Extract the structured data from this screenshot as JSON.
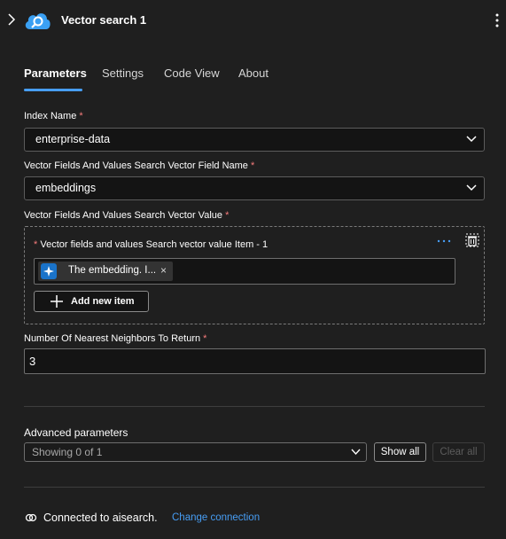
{
  "header": {
    "title": "Vector search 1",
    "expand_icon": "chevron-right-icon",
    "logo_icon": "azure-ai-search-icon",
    "menu_icon": "more-vertical-icon",
    "accent_color": "#479ef5"
  },
  "tabs": [
    {
      "label": "Parameters",
      "active": true
    },
    {
      "label": "Settings",
      "active": false
    },
    {
      "label": "Code View",
      "active": false
    },
    {
      "label": "About",
      "active": false
    }
  ],
  "fields": {
    "index_name": {
      "label": "Index Name",
      "required_mark": "*",
      "value": "enterprise-data"
    },
    "vector_field_name": {
      "label": "Vector Fields And Values Search Vector Field Name",
      "required_mark": "*",
      "value": "embeddings"
    },
    "vector_value": {
      "label": "Vector Fields And Values Search Vector Value",
      "required_mark": "*",
      "item_label": "Vector fields and values Search vector value Item - 1",
      "item_required_mark": "*",
      "token_text": "The embedding. I...",
      "token_remove": "×",
      "add_button": "Add new item"
    },
    "nearest_neighbors": {
      "label": "Number Of Nearest Neighbors To Return",
      "required_mark": "*",
      "value": "3"
    }
  },
  "advanced": {
    "label": "Advanced parameters",
    "select_value": "Showing 0 of 1",
    "show_all": "Show all",
    "clear_all": "Clear all"
  },
  "connection": {
    "text": "Connected to aisearch.",
    "link": "Change connection"
  }
}
